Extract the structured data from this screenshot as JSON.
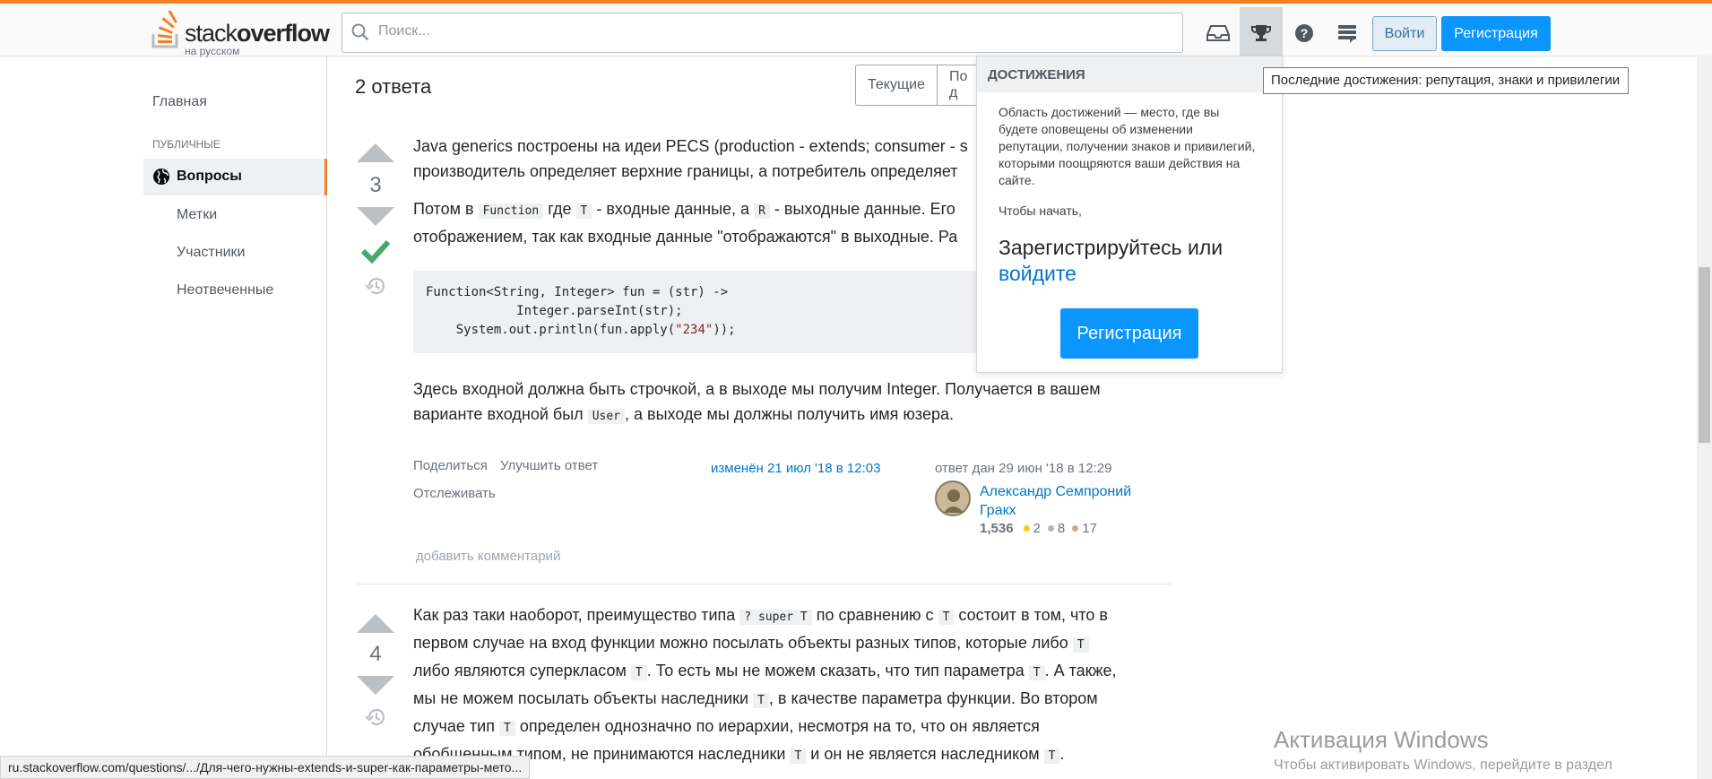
{
  "header": {
    "logo_main": "stack",
    "logo_bold": "overflow",
    "logo_sub": "на русском",
    "search_placeholder": "Поиск...",
    "login_label": "Войти",
    "signup_label": "Регистрация",
    "accent": "#f48024",
    "icons": [
      "inbox-icon",
      "trophy-icon",
      "help-icon",
      "site-switcher-icon"
    ]
  },
  "sidebar": {
    "home": "Главная",
    "section": "ПУБЛИЧНЫЕ",
    "active": "Вопросы",
    "items": [
      "Метки",
      "Участники",
      "Неотвеченные"
    ]
  },
  "answers": {
    "title": "2 ответа",
    "tabs": [
      "Текущие",
      "По д"
    ],
    "first": {
      "score": "3",
      "p1_line1": "Java generics построены на идеи PECS (production - extends; consumer - s",
      "p1_line2": "производитель определяет верхние границы, а потребитель определяет",
      "p2_before_function": "Потом в",
      "code_function": "Function",
      "p2_where": "где",
      "code_t": "T",
      "p2_mid": "- входные данные, а",
      "code_r": "R",
      "p2_end": "- выходные данные. Его",
      "p2_line2": "отображением, так как входные данные \"отображаются\" в выходные. Ра",
      "code_line1": "Function<String, Integer> fun = (str) ->",
      "code_line2": "            Integer.parseInt(str);",
      "code_line3_pre": "    System.out.println(fun.apply(",
      "code_line3_str": "\"234\"",
      "code_line3_post": "));",
      "p3_line1": "Здесь входной должна быть строчкой, а в выходе мы получим Integer. Получается в вашем",
      "p3_before_user": "варианте входной был",
      "code_user": "User",
      "p3_after_user": ", а выходе мы должны получить имя юзера.",
      "share": "Поделиться",
      "improve": "Улучшить ответ",
      "follow": "Отслеживать",
      "edited": "изменён 21 июл '18 в 12:03",
      "answered": "ответ дан 29 июн '18 в 12:29",
      "author_line1": "Александр Семпроний",
      "author_line2": "Гракх",
      "reputation": "1,536",
      "gold": "2",
      "silver": "8",
      "bronze": "17",
      "add_comment": "добавить комментарий"
    },
    "second": {
      "score": "4",
      "l1_a": "Как раз таки наоборот, преимущество типа",
      "l1_code1": "? super T",
      "l1_b": "по сравнению с",
      "l1_code2": "T",
      "l1_c": "состоит в том, что в",
      "l2_a": "первом случае на вход функции можно посылать объекты разных типов, которые либо",
      "l2_code": "T",
      "l3_a": "либо являются суперкласом",
      "l3_code": "T",
      "l3_b": ". То есть мы не можем сказать, что тип параметра",
      "l3_code2": "T",
      "l3_c": ". А также,",
      "l4_a": "мы не можем посылать объекты наследники",
      "l4_code": "T",
      "l4_b": ", в качестве параметра функции. Во втором",
      "l5_a": "случае тип",
      "l5_code": "T",
      "l5_b": "определен однозначно по иерархии, несмотря на то, что он является",
      "l6_a": "обобщенным типом, не принимаются наследники",
      "l6_code": "T",
      "l6_b": "и он не является наследником",
      "l6_code2": "T",
      "l6_c": "."
    }
  },
  "popover": {
    "title": "ДОСТИЖЕНИЯ",
    "body": "Область достижений — место, где вы будете оповещены об изменении репутации, получении знаков и привилегий, которыми поощряются ваши действия на сайте.",
    "start": "Чтобы начать,",
    "cta_text": "Зарегистрируйтесь или",
    "cta_link": "войдите",
    "button": "Регистрация"
  },
  "tooltip": "Последние достижения: репутация, знаки и привилегии",
  "status_url": "ru.stackoverflow.com/questions/.../Для-чего-нужны-extends-и-super-как-параметры-мето...",
  "activation": {
    "title": "Активация Windows",
    "subtitle": "Чтобы активировать Windows, перейдите в раздел"
  }
}
